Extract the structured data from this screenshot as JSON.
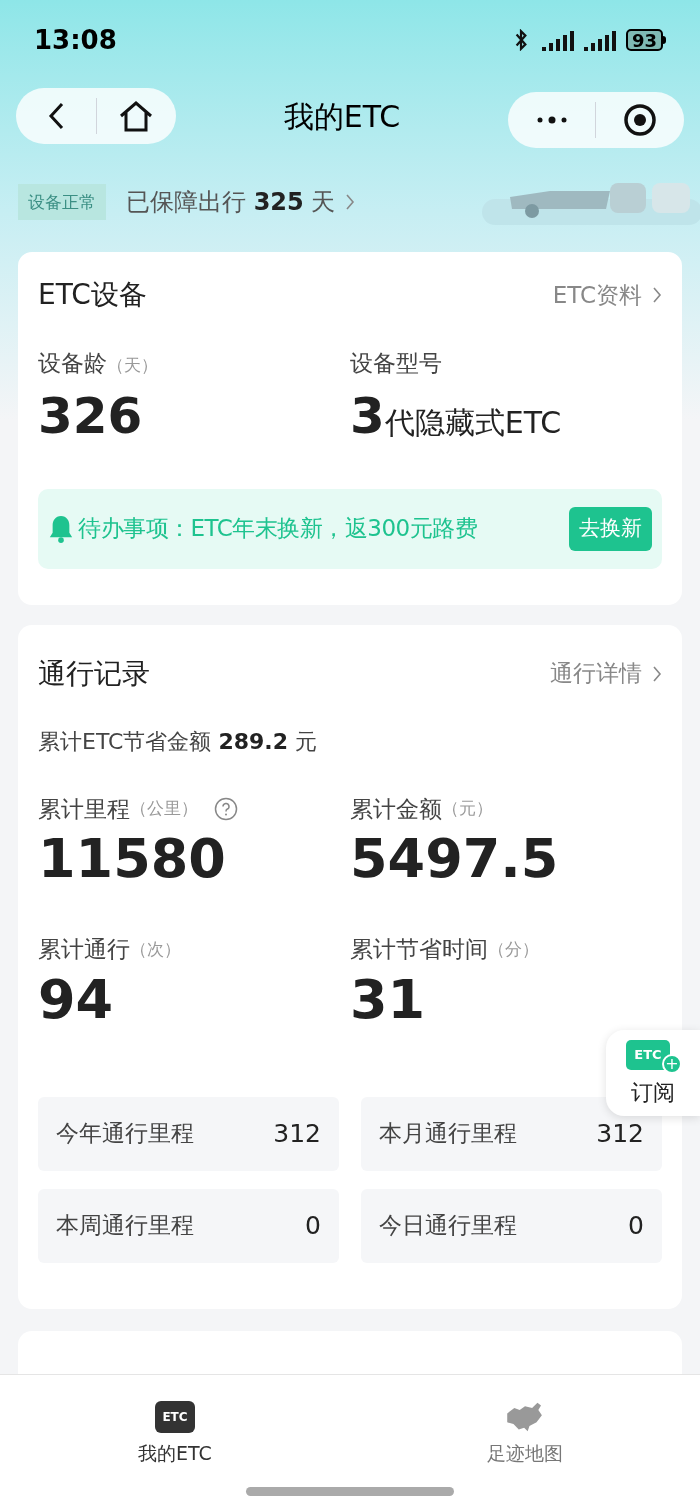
{
  "status_bar": {
    "time": "13:08",
    "battery": "93"
  },
  "nav": {
    "title": "我的ETC"
  },
  "device_status": {
    "badge": "设备正常",
    "prefix": "已保障出行",
    "days": "325",
    "suffix": "天"
  },
  "device_card": {
    "title": "ETC设备",
    "link": "ETC资料",
    "stats": [
      {
        "label": "设备龄",
        "unit": "（天）",
        "value": "326",
        "kind": "number"
      },
      {
        "label": "设备型号",
        "value_big": "3",
        "value_rest": "代隐藏式ETC",
        "kind": "model"
      }
    ],
    "todo": {
      "text": "待办事项：ETC年末换新，返300元路费",
      "button": "去换新"
    }
  },
  "travel_card": {
    "title": "通行记录",
    "link": "通行详情",
    "savings_label": "累计ETC节省金额",
    "savings_value": "289.2",
    "savings_unit": "元",
    "stats": [
      {
        "label": "累计里程",
        "unit": "（公里）",
        "value": "11580",
        "help": true
      },
      {
        "label": "累计金额",
        "unit": "（元）",
        "value": "5497.5",
        "help": false
      },
      {
        "label": "累计通行",
        "unit": "（次）",
        "value": "94",
        "help": false
      },
      {
        "label": "累计节省时间",
        "unit": "（分）",
        "value": "31",
        "help": false
      }
    ],
    "mileage": [
      {
        "label": "今年通行里程",
        "value": "312"
      },
      {
        "label": "本月通行里程",
        "value": "312"
      },
      {
        "label": "本周通行里程",
        "value": "0"
      },
      {
        "label": "今日通行里程",
        "value": "0"
      }
    ]
  },
  "subscribe": {
    "badge": "ETC",
    "plus": "+",
    "label": "订阅"
  },
  "tab_bar": [
    {
      "icon_text": "ETC",
      "label": "我的ETC",
      "kind": "etc",
      "selected": true
    },
    {
      "label": "足迹地图",
      "kind": "map",
      "selected": false
    }
  ]
}
